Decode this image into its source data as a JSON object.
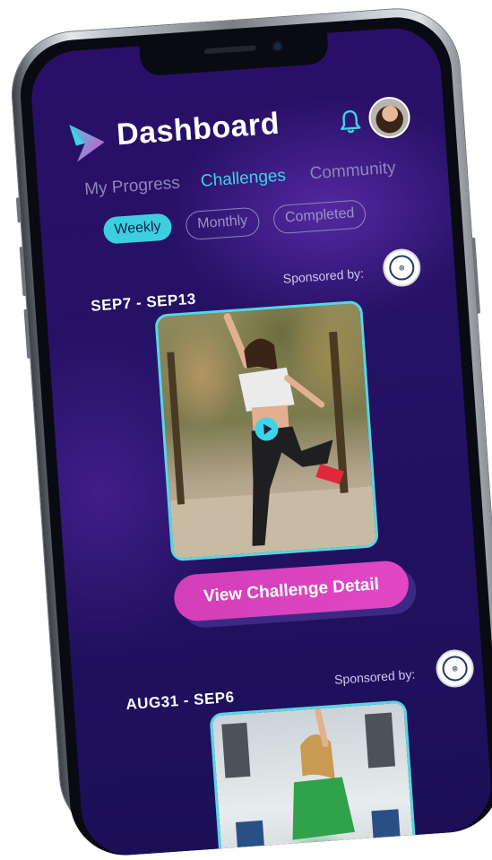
{
  "app": {
    "title": "Dashboard"
  },
  "header": {
    "logo_icon": "brand-logo-icon",
    "bell_icon": "bell-icon",
    "avatar_icon": "user-avatar",
    "accent_color": "#3fd3e6"
  },
  "tabs": [
    {
      "label": "My Progress",
      "active": false
    },
    {
      "label": "Challenges",
      "active": true
    },
    {
      "label": "Community",
      "active": false
    }
  ],
  "filters": [
    {
      "label": "Weekly",
      "active": true
    },
    {
      "label": "Monthly",
      "active": false
    },
    {
      "label": "Completed",
      "active": false
    }
  ],
  "challenges": [
    {
      "date_range": "SEP7 - SEP13",
      "sponsor_label": "Sponsored by:",
      "cta_label": "View Challenge Detail"
    },
    {
      "date_range": "AUG31 - SEP6",
      "sponsor_label": "Sponsored by:"
    }
  ],
  "colors": {
    "background": "#241264",
    "cta": "#e247c3",
    "active_chip": "#3dcfe0",
    "card_border": "#58d6e4"
  }
}
